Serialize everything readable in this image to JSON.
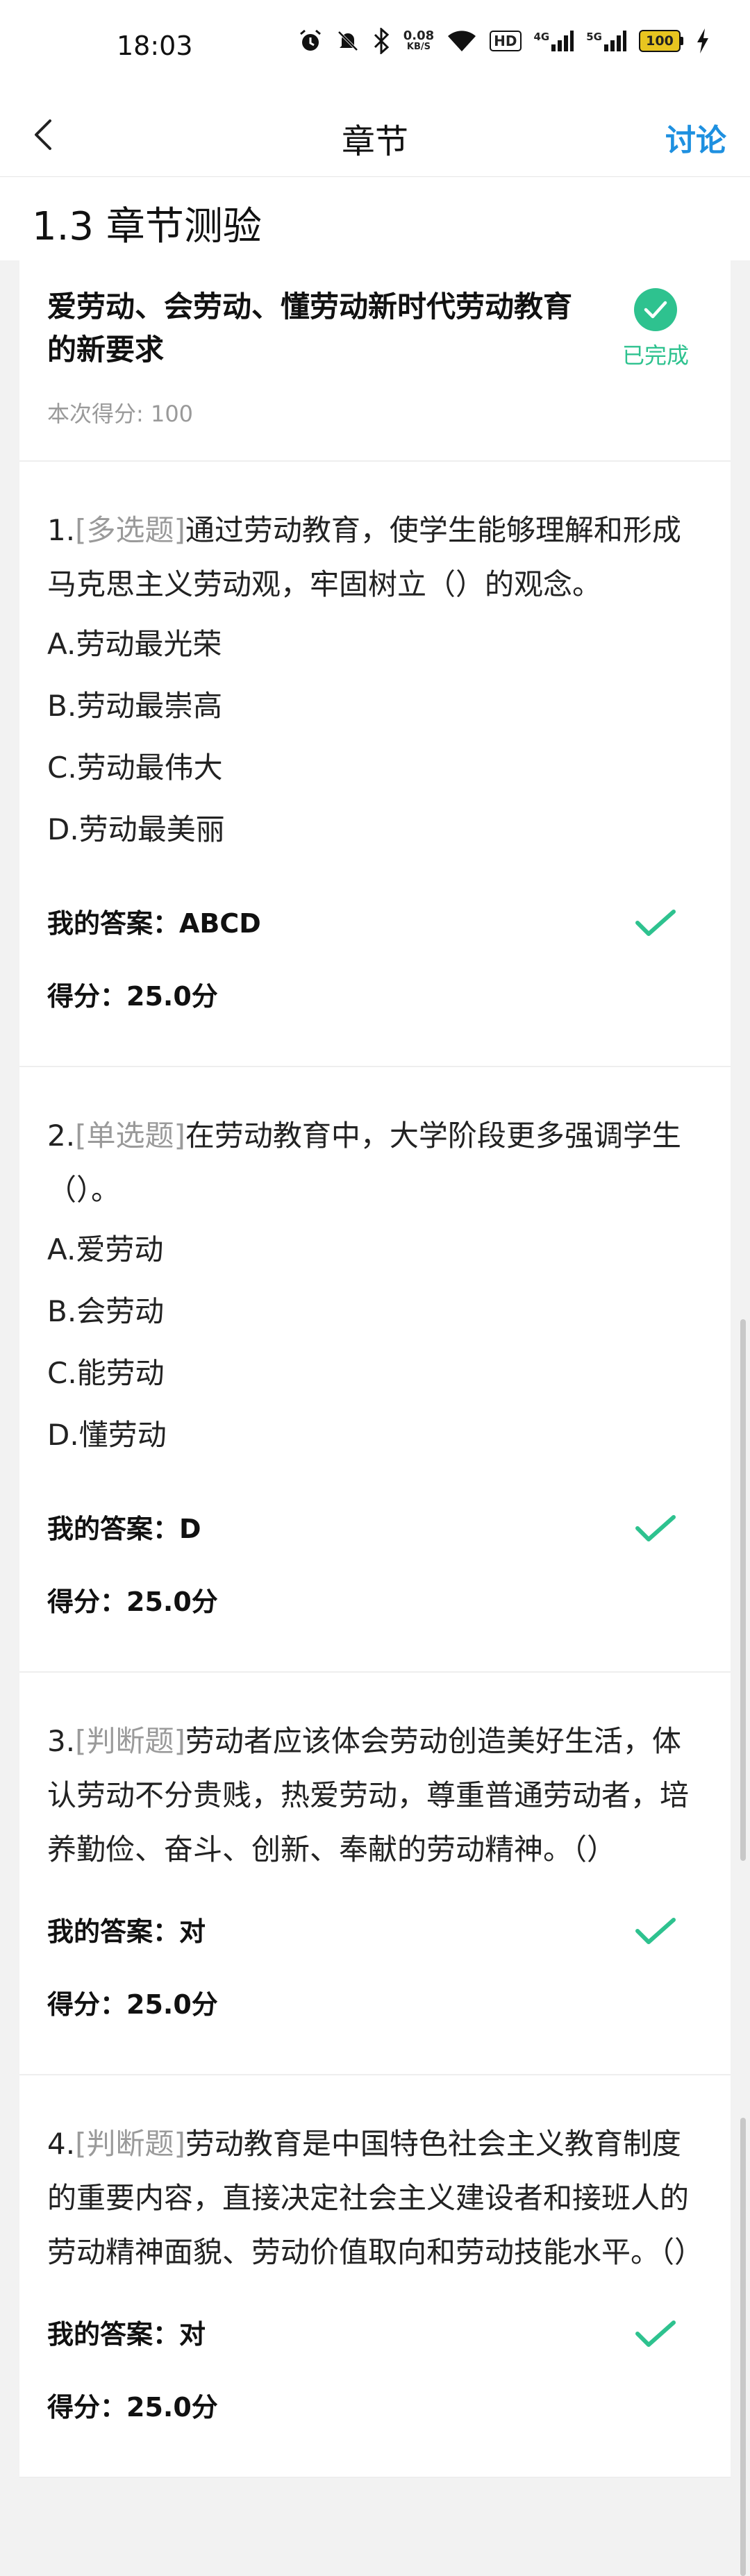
{
  "status": {
    "time": "18:03",
    "net_speed": "0.08",
    "net_unit": "KB/S",
    "hd": "HD",
    "sig1": "4G",
    "sig2": "5G",
    "battery": "100"
  },
  "nav": {
    "title": "章节",
    "action": "讨论"
  },
  "chapter": {
    "title": "1.3 章节测验"
  },
  "quiz": {
    "title": "爱劳动、会劳动、懂劳动新时代劳动教育的新要求",
    "status": "已完成",
    "score_text": "本次得分: 100"
  },
  "colors": {
    "accent": "#1e90e0",
    "success": "#2ec28f"
  },
  "answer_label": "我的答案：",
  "score_label": "得分：",
  "questions": [
    {
      "number": "1.",
      "type": "[多选题]",
      "text": "通过劳动教育，使学生能够理解和形成马克思主义劳动观，牢固树立（）的观念。",
      "options": [
        "A.劳动最光荣",
        "B.劳动最崇高",
        "C.劳动最伟大",
        "D.劳动最美丽"
      ],
      "answer": "ABCD",
      "score": "25.0分"
    },
    {
      "number": "2.",
      "type": "[单选题]",
      "text": "在劳动教育中，大学阶段更多强调学生（）。",
      "options": [
        "A.爱劳动",
        "B.会劳动",
        "C.能劳动",
        "D.懂劳动"
      ],
      "answer": "D",
      "score": "25.0分"
    },
    {
      "number": "3.",
      "type": "[判断题]",
      "text": "劳动者应该体会劳动创造美好生活，体认劳动不分贵贱，热爱劳动，尊重普通劳动者，培养勤俭、奋斗、创新、奉献的劳动精神。（）",
      "options": [],
      "answer": "对",
      "score": "25.0分"
    },
    {
      "number": "4.",
      "type": "[判断题]",
      "text": "劳动教育是中国特色社会主义教育制度的重要内容，直接决定社会主义建设者和接班人的劳动精神面貌、劳动价值取向和劳动技能水平。（）",
      "options": [],
      "answer": "对",
      "score": "25.0分"
    }
  ]
}
